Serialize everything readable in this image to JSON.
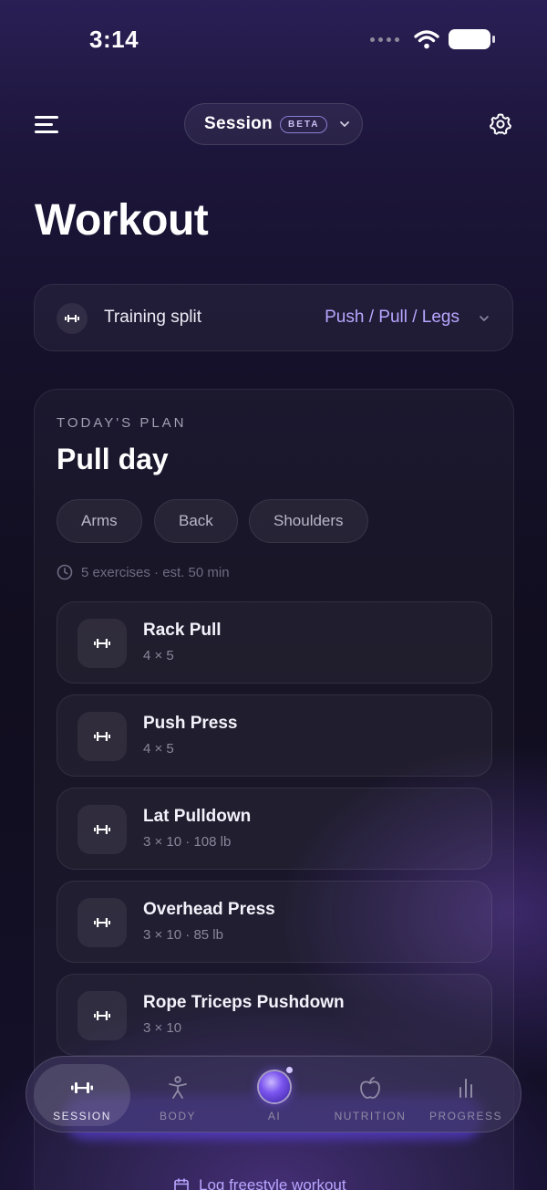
{
  "status_bar": {
    "time": "3:14"
  },
  "header": {
    "session_label": "Session",
    "beta_label": "BETA"
  },
  "page": {
    "title": "Workout"
  },
  "split": {
    "label": "Training split",
    "value": "Push / Pull / Legs"
  },
  "plan": {
    "eyebrow": "TODAY'S PLAN",
    "title": "Pull day",
    "tags": [
      "Arms",
      "Back",
      "Shoulders"
    ],
    "meta": "5 exercises · est. 50 min",
    "exercises": [
      {
        "name": "Rack Pull",
        "detail": "4 × 5"
      },
      {
        "name": "Push Press",
        "detail": "4 × 5"
      },
      {
        "name": "Lat Pulldown",
        "detail": "3 × 10 · 108 lb"
      },
      {
        "name": "Overhead Press",
        "detail": "3 × 10 · 85 lb"
      },
      {
        "name": "Rope Triceps Pushdown",
        "detail": "3 × 10"
      }
    ],
    "freestyle_label": "Log freestyle workout"
  },
  "nav": {
    "items": [
      {
        "label": "SESSION",
        "icon": "dumbbell-icon",
        "active": true
      },
      {
        "label": "BODY",
        "icon": "person-icon",
        "active": false
      },
      {
        "label": "AI",
        "icon": "ai-orb-icon",
        "active": false
      },
      {
        "label": "NUTRITION",
        "icon": "apple-icon",
        "active": false
      },
      {
        "label": "PROGRESS",
        "icon": "bar-chart-icon",
        "active": false
      }
    ]
  },
  "colors": {
    "accent": "#b8a6ff",
    "background": "#15112a"
  }
}
